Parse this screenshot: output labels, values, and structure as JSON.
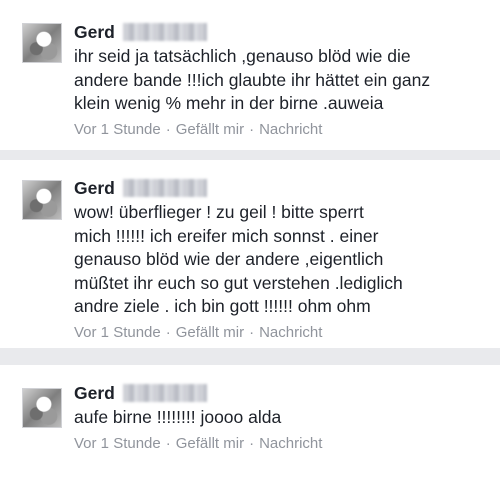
{
  "comments": [
    {
      "author": "Gerd",
      "text": "ihr seid ja tatsächlich ,genauso blöd wie die\nandere bande !!!ich glaubte ihr hättet ein ganz\nklein wenig % mehr in der birne .auweia",
      "time": "Vor 1 Stunde",
      "like_label": "Gefällt mir",
      "message_label": "Nachricht",
      "separator": "·"
    },
    {
      "author": "Gerd",
      "text": "wow! überflieger ! zu geil ! bitte sperrt\nmich !!!!!! ich ereifer mich sonnst . einer\ngenauso blöd wie der andere ,eigentlich\nmüßtet ihr euch so gut verstehen .lediglich\nandre ziele . ich bin gott !!!!!! ohm ohm",
      "time": "Vor 1 Stunde",
      "like_label": "Gefällt mir",
      "message_label": "Nachricht",
      "separator": "·"
    },
    {
      "author": "Gerd",
      "text": "aufe birne !!!!!!!! joooo alda",
      "time": "Vor 1 Stunde",
      "like_label": "Gefällt mir",
      "message_label": "Nachricht",
      "separator": "·"
    }
  ]
}
